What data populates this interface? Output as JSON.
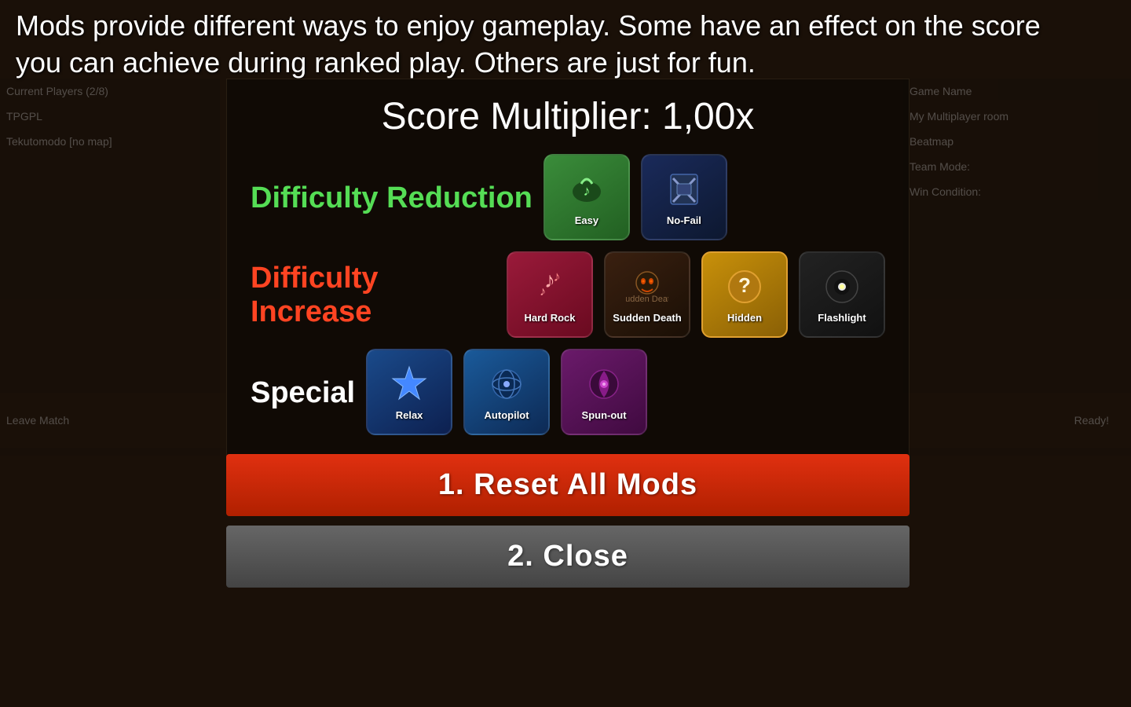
{
  "description": {
    "line1": "Mods provide different ways to enjoy gameplay. Some have an effect on the score",
    "line2": "you can achieve during ranked play. Others are just for fun."
  },
  "score_multiplier": {
    "label": "Score Multiplier: 1,00x"
  },
  "sections": {
    "difficulty_reduction": {
      "label": "Difficulty Reduction",
      "mods": [
        {
          "id": "easy",
          "name": "Easy",
          "class": "mod-easy"
        },
        {
          "id": "nofail",
          "name": "No-Fail",
          "class": "mod-nofail"
        }
      ]
    },
    "difficulty_increase": {
      "label": "Difficulty Increase",
      "mods": [
        {
          "id": "hardrock",
          "name": "Hard Rock",
          "class": "mod-hardrock"
        },
        {
          "id": "suddendeath",
          "name": "Sudden Death",
          "class": "mod-suddendeath"
        },
        {
          "id": "hidden",
          "name": "Hidden",
          "class": "mod-hidden"
        },
        {
          "id": "flashlight",
          "name": "Flashlight",
          "class": "mod-flashlight"
        }
      ]
    },
    "special": {
      "label": "Special",
      "mods": [
        {
          "id": "relax",
          "name": "Relax",
          "class": "mod-relax"
        },
        {
          "id": "autopilot",
          "name": "Autopilot",
          "class": "mod-autopilot"
        },
        {
          "id": "spunout",
          "name": "Spun-out",
          "class": "mod-spunout"
        }
      ]
    }
  },
  "buttons": {
    "reset": "1. Reset All Mods",
    "close": "2. Close"
  },
  "bg": {
    "current_players": "Current Players (2/8)",
    "game_name_label": "Game Name",
    "game_name_value": "My Multiplayer room",
    "beatmap_label": "Beatmap",
    "leave_match": "Leave Match",
    "ready": "Ready!",
    "player1": "TPGPL",
    "player2": "Tekutomodo [no map]",
    "team_mode": "Team Mode:",
    "win_condition": "Win Condition:"
  }
}
